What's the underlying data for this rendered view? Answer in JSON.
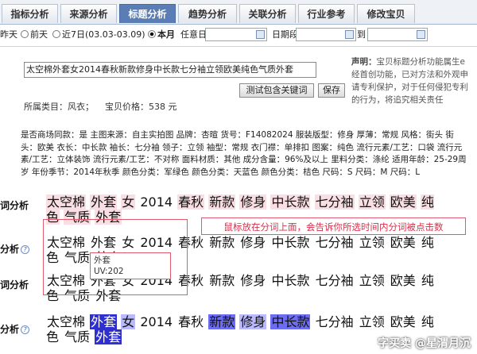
{
  "tabs": [
    {
      "label": "指标分析"
    },
    {
      "label": "来源分析"
    },
    {
      "label": "标题分析"
    },
    {
      "label": "趋势分析"
    },
    {
      "label": "关联分析"
    },
    {
      "label": "行业参考"
    },
    {
      "label": "修改宝贝"
    }
  ],
  "date_filter": {
    "yesterday": "昨天",
    "day_before": "前天",
    "last7": "近7日(03.03-03.09)",
    "this_month": "本月",
    "any_date": "任意日",
    "date_range": "日期段",
    "to": "到"
  },
  "title_input": {
    "value": "太空棉外套女2014春秋新款修身中长款七分袖立领欧美纯色气质外套"
  },
  "buttons": {
    "test_keywords": "测试包含关键词",
    "save": "保存"
  },
  "meta": {
    "category": "所属类目：风衣；",
    "price": "宝贝价格：538 元"
  },
  "declaration": {
    "label": "声明：",
    "text": "宝贝标题分析功能属生e经首创功能，已对方法和外观申请专利保护，对于任何侵犯专利的行为，将追究相关责任"
  },
  "attributes": "是否商场同款：是 主图来源：自主实拍图 品牌：杏暄 货号：F14082024 服装版型：修身 厚薄：常规 风格：街头 街头：欧美 衣长：中长款 袖长：七分袖 领子：立领 袖型：常规 衣门襟：单排扣 图案：纯色 流行元素/工艺：口袋 流行元素/工艺：立体装饰 流行元素/工艺：不对称 面料材质：其他 成分含量：96%及以上 里料分类：涤纶 适用年龄：25-29周岁 年份季节：2014年秋季 颜色分类：军绿色 颜色分类：天蓝色 颜色分类：桔色 尺码：S 尺码：M 尺码：L",
  "analysis_rows": [
    {
      "label": "词分析",
      "has_help": false
    },
    {
      "label": "分析",
      "has_help": true
    },
    {
      "label": "词分析",
      "has_help": false
    },
    {
      "label": "分析",
      "has_help": true
    }
  ],
  "words": [
    "太空棉",
    "外套",
    "女",
    "2014",
    "春秋",
    "新款",
    "修身",
    "中长款",
    "七分袖",
    "立领",
    "欧美",
    "纯色",
    "气质",
    "外套"
  ],
  "callout": "鼠标放在分词上面，会告诉你所选时间内分词被点击数",
  "tooltip": {
    "word": "外套",
    "uv": "UV:202"
  },
  "watermark": "字买卖 @星渭月沉",
  "colors": {
    "tab_active": "#5a7db5",
    "row1_highlight": "#f9dfe3",
    "row4_dark": "#2f2fd0",
    "row4_mid": "#6d6df2",
    "row4_light": "#b9b9fb",
    "callout_red": "#e05a6e"
  }
}
